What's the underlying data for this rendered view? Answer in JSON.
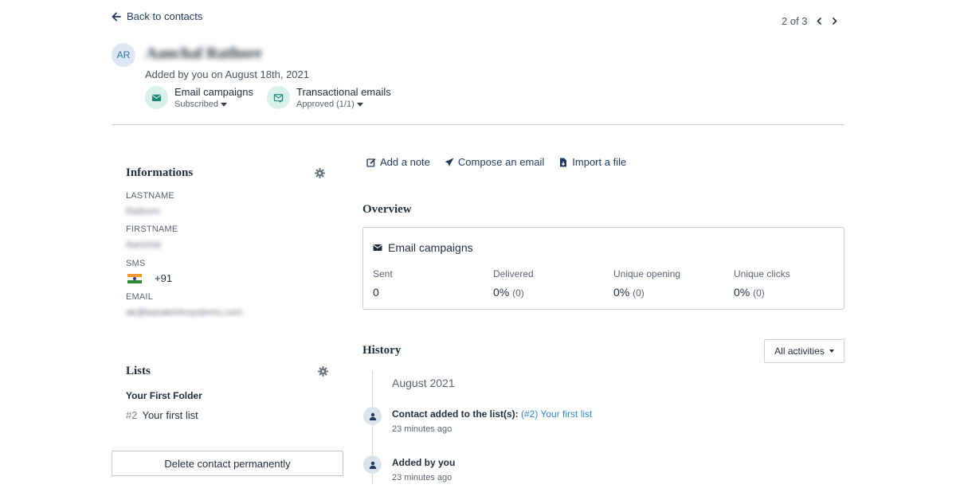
{
  "nav": {
    "back_label": "Back to contacts",
    "pager_text": "2 of 3"
  },
  "contact": {
    "initials": "AR",
    "name": "Aanchal Rathore",
    "added_text": "Added by you on August 18th, 2021"
  },
  "subscriptions": [
    {
      "title": "Email campaigns",
      "status": "Subscribed"
    },
    {
      "title": "Transactional emails",
      "status": "Approved (1/1)"
    }
  ],
  "informations": {
    "title": "Informations",
    "fields": [
      {
        "label": "LASTNAME",
        "value": "Rathore"
      },
      {
        "label": "FIRSTNAME",
        "value": "Aanchal"
      },
      {
        "label": "SMS",
        "value": "+91"
      },
      {
        "label": "EMAIL",
        "value": "ak@kanakinfosystems.com"
      }
    ]
  },
  "lists": {
    "title": "Lists",
    "folder": "Your First Folder",
    "items": [
      {
        "num": "#2",
        "name": "Your first list"
      }
    ]
  },
  "delete_label": "Delete contact permanently",
  "actions": {
    "add_note": "Add a note",
    "compose": "Compose an email",
    "import": "Import a file"
  },
  "overview": {
    "title": "Overview",
    "card_title": "Email campaigns",
    "stats": [
      {
        "label": "Sent",
        "value": "0",
        "extra": ""
      },
      {
        "label": "Delivered",
        "value": "0%",
        "extra": "(0)"
      },
      {
        "label": "Unique opening",
        "value": "0%",
        "extra": "(0)"
      },
      {
        "label": "Unique clicks",
        "value": "0%",
        "extra": "(0)"
      }
    ]
  },
  "history": {
    "title": "History",
    "filter_label": "All activities",
    "month": "August 2021",
    "events": [
      {
        "text": "Contact added to the list(s):",
        "link": "(#2) Your first list",
        "time": "23 minutes ago"
      },
      {
        "text": "Added by you",
        "link": "",
        "time": "23 minutes ago"
      }
    ]
  },
  "colors": {
    "accent_link": "#2b87d9",
    "subscription_icon_bg": "#d9f0ea",
    "subscription_icon": "#1a8a74",
    "avatar_bg": "#dde7f3"
  }
}
